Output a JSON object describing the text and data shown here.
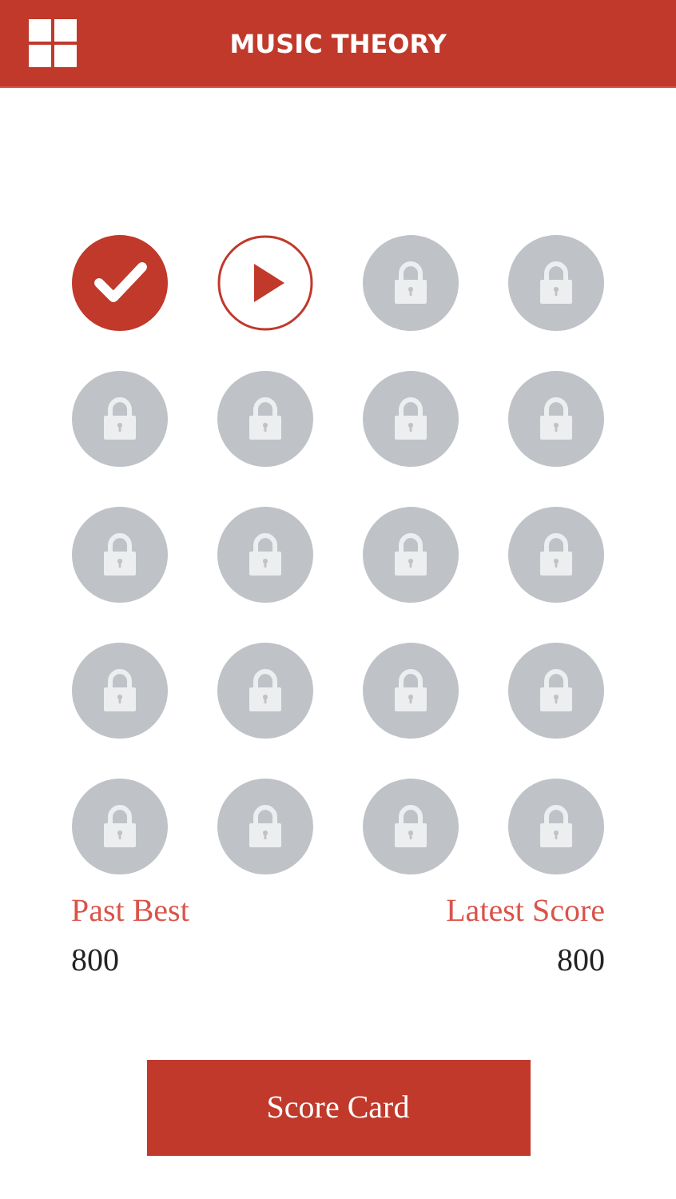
{
  "header": {
    "title": "MUSIC THEORY"
  },
  "levels": [
    {
      "kind": "done"
    },
    {
      "kind": "current"
    },
    {
      "kind": "locked"
    },
    {
      "kind": "locked"
    },
    {
      "kind": "locked"
    },
    {
      "kind": "locked"
    },
    {
      "kind": "locked"
    },
    {
      "kind": "locked"
    },
    {
      "kind": "locked"
    },
    {
      "kind": "locked"
    },
    {
      "kind": "locked"
    },
    {
      "kind": "locked"
    },
    {
      "kind": "locked"
    },
    {
      "kind": "locked"
    },
    {
      "kind": "locked"
    },
    {
      "kind": "locked"
    },
    {
      "kind": "locked"
    },
    {
      "kind": "locked"
    },
    {
      "kind": "locked"
    },
    {
      "kind": "locked"
    }
  ],
  "scores": {
    "past_best_label": "Past Best",
    "past_best": "800",
    "latest_label": "Latest Score",
    "latest": "800"
  },
  "button": "Score Card"
}
